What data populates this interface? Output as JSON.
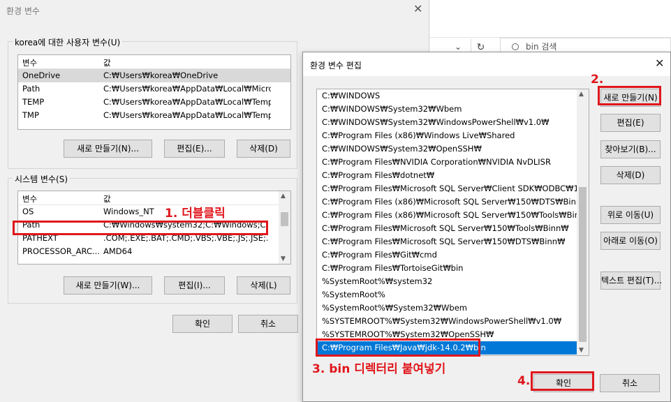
{
  "explorer": {
    "search_placeholder": "bin 검색",
    "chevron": "⌄",
    "refresh": "↻"
  },
  "main_dialog": {
    "title": "환경 변수",
    "close": "✕",
    "user_group": {
      "label": "korea에 대한 사용자 변수(U)",
      "headers": [
        "변수",
        "값"
      ],
      "rows": [
        {
          "name": "OneDrive",
          "value": "C:₩Users₩korea₩OneDrive"
        },
        {
          "name": "Path",
          "value": "C:₩Users₩korea₩AppData₩Local₩Microso..."
        },
        {
          "name": "TEMP",
          "value": "C:₩Users₩korea₩AppData₩Local₩Temp"
        },
        {
          "name": "TMP",
          "value": "C:₩Users₩korea₩AppData₩Local₩Temp"
        }
      ],
      "buttons": {
        "new": "새로 만들기(N)...",
        "edit": "편집(E)...",
        "delete": "삭제(D)"
      }
    },
    "system_group": {
      "label": "시스템 변수(S)",
      "headers": [
        "변수",
        "값"
      ],
      "rows": [
        {
          "name": "OS",
          "value": "Windows_NT"
        },
        {
          "name": "Path",
          "value": "C:₩Windows₩system32;C:₩Windows;C:₩..."
        },
        {
          "name": "PATHEXT",
          "value": ".COM;.EXE;.BAT;.CMD;.VBS;.VBE;.JS;.JSE;.W..."
        },
        {
          "name": "PROCESSOR_ARC...",
          "value": "AMD64"
        }
      ],
      "buttons": {
        "new": "새로 만들기(W)...",
        "edit": "편집(I)...",
        "delete": "삭제(L)"
      }
    },
    "ok": "확인",
    "cancel": "취소"
  },
  "edit_dialog": {
    "title": "환경 변수 편집",
    "close": "✕",
    "items": [
      "C:₩WINDOWS",
      "C:₩WINDOWS₩System32₩Wbem",
      "C:₩WINDOWS₩System32₩WindowsPowerShell₩v1.0₩",
      "C:₩Program Files (x86)₩Windows Live₩Shared",
      "C:₩WINDOWS₩System32₩OpenSSH₩",
      "C:₩Program Files₩NVIDIA Corporation₩NVIDIA NvDLISR",
      "C:₩Program Files₩dotnet₩",
      "C:₩Program Files₩Microsoft SQL Server₩Client SDK₩ODBC₩17...",
      "C:₩Program Files (x86)₩Microsoft SQL Server₩150₩DTS₩Binn₩",
      "C:₩Program Files (x86)₩Microsoft SQL Server₩150₩Tools₩Binn₩",
      "C:₩Program Files₩Microsoft SQL Server₩150₩Tools₩Binn₩",
      "C:₩Program Files₩Microsoft SQL Server₩150₩DTS₩Binn₩",
      "C:₩Program Files₩Git₩cmd",
      "C:₩Program Files₩TortoiseGit₩bin",
      "%SystemRoot%₩system32",
      "%SystemRoot%",
      "%SystemRoot%₩System32₩Wbem",
      "%SYSTEMROOT%₩System32₩WindowsPowerShell₩v1.0₩",
      "%SYSTEMROOT%₩System32₩OpenSSH₩",
      "C:₩Program Files₩Java₩jdk-14.0.2₩bin"
    ],
    "buttons": {
      "new": "새로 만들기(N)",
      "edit": "편집(E)",
      "browse": "찾아보기(B)...",
      "delete": "삭제(D)",
      "move_up": "위로 이동(U)",
      "move_down": "아래로 이동(O)",
      "edit_text": "텍스트 편집(T)...",
      "ok": "확인",
      "cancel": "취소"
    }
  },
  "annotations": {
    "step1": "1. 더블클릭",
    "step2": "2.",
    "step3": "3. bin 디렉터리 붙여넣기",
    "step4": "4.",
    "color": "#e0161c"
  },
  "colors": {
    "selection_blue": "#0078d7",
    "accent_red": "#e0161c"
  }
}
